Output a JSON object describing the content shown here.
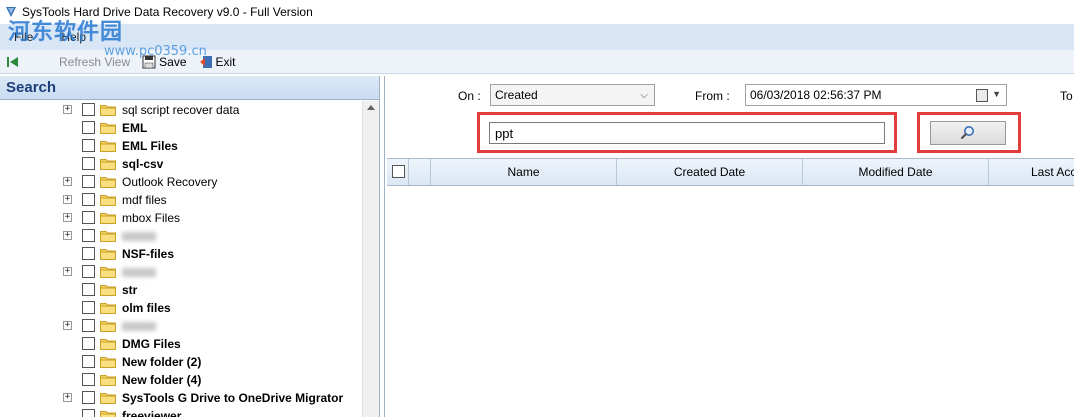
{
  "window": {
    "title": "SysTools Hard Drive Data Recovery v9.0 - Full Version"
  },
  "watermark": {
    "text": "河东软件园",
    "url": "www.pc0359.cn"
  },
  "menu": {
    "items": [
      "File",
      "Help"
    ]
  },
  "toolbar": {
    "refresh_label": "Refresh View",
    "save_label": "Save",
    "exit_label": "Exit"
  },
  "left_panel": {
    "header": "Search",
    "tree": [
      {
        "label": "sql script recover data",
        "bold": false,
        "expandable": true
      },
      {
        "label": "EML",
        "bold": true,
        "expandable": false
      },
      {
        "label": "EML Files",
        "bold": true,
        "expandable": false
      },
      {
        "label": "sql-csv",
        "bold": true,
        "expandable": false
      },
      {
        "label": "Outlook Recovery",
        "bold": false,
        "expandable": true
      },
      {
        "label": "mdf files",
        "bold": false,
        "expandable": true
      },
      {
        "label": "mbox Files",
        "bold": false,
        "expandable": true
      },
      {
        "label": "",
        "bold": false,
        "expandable": true,
        "blurred": true
      },
      {
        "label": "NSF-files",
        "bold": true,
        "expandable": false
      },
      {
        "label": "",
        "bold": false,
        "expandable": true,
        "blurred": true
      },
      {
        "label": "str",
        "bold": true,
        "expandable": false
      },
      {
        "label": "olm files",
        "bold": true,
        "expandable": false
      },
      {
        "label": "",
        "bold": false,
        "expandable": true,
        "blurred": true
      },
      {
        "label": "DMG Files",
        "bold": true,
        "expandable": false
      },
      {
        "label": "New folder (2)",
        "bold": true,
        "expandable": false
      },
      {
        "label": "New folder (4)",
        "bold": true,
        "expandable": false
      },
      {
        "label": "SysTools G Drive to OneDrive Migrator",
        "bold": true,
        "expandable": true
      },
      {
        "label": "freeviewer",
        "bold": true,
        "expandable": false
      }
    ]
  },
  "filter": {
    "on_label": "On :",
    "on_value": "Created",
    "from_label": "From :",
    "from_value": "06/03/2018 02:56:37 PM",
    "to_label": "To"
  },
  "search": {
    "value": "ppt"
  },
  "grid": {
    "columns": [
      "Name",
      "Created Date",
      "Modified Date",
      "Last Acc"
    ]
  },
  "colors": {
    "highlight": "#e23c3c",
    "menubar": "#d8e6f5",
    "panel_header_text": "#1c3f7a"
  }
}
